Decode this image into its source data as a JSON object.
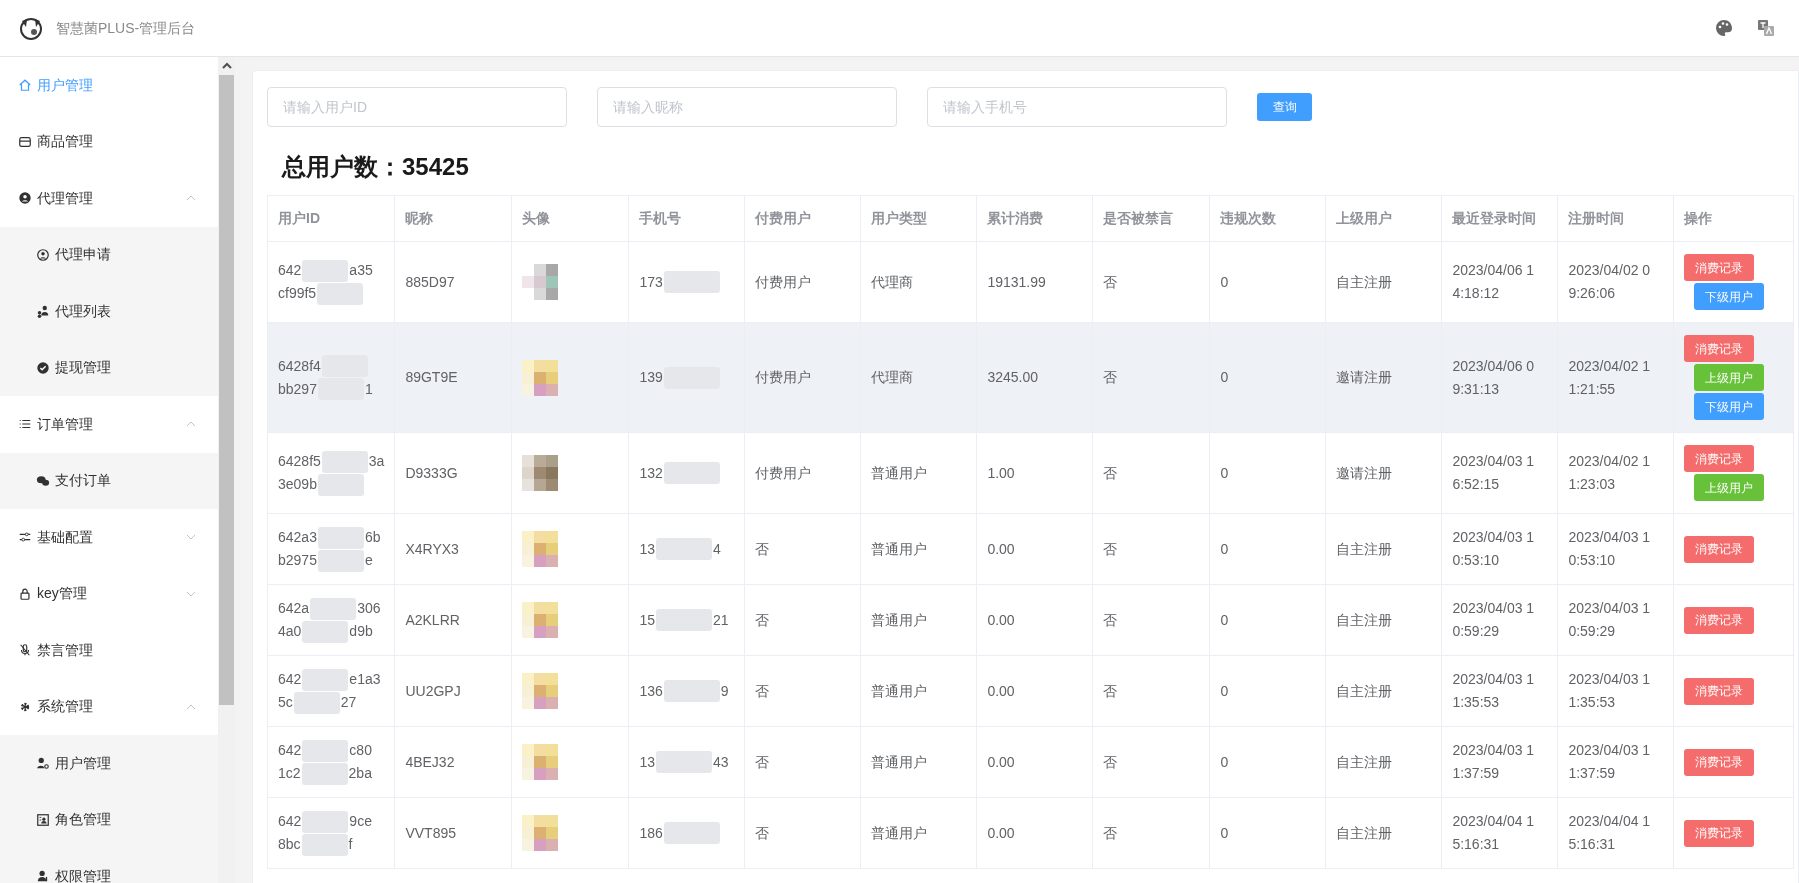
{
  "header": {
    "title": "智慧菌PLUS-管理后台"
  },
  "sidebar": {
    "items": [
      {
        "label": "用户管理",
        "selected": true
      },
      {
        "label": "商品管理",
        "selected": false
      },
      {
        "label": "代理管理",
        "selected": false,
        "expanded": true,
        "children": [
          {
            "label": "代理申请",
            "selected": false
          },
          {
            "label": "代理列表",
            "selected": false
          },
          {
            "label": "提现管理",
            "selected": false
          }
        ]
      },
      {
        "label": "订单管理",
        "selected": false,
        "expanded": true,
        "children": [
          {
            "label": "支付订单",
            "selected": false
          }
        ]
      },
      {
        "label": "基础配置",
        "selected": false,
        "expanded": false
      },
      {
        "label": "key管理",
        "selected": false,
        "expanded": false
      },
      {
        "label": "禁言管理",
        "selected": false
      },
      {
        "label": "系统管理",
        "selected": false,
        "expanded": true,
        "children": [
          {
            "label": "用户管理",
            "selected": false
          },
          {
            "label": "角色管理",
            "selected": false
          },
          {
            "label": "权限管理",
            "selected": false
          }
        ]
      }
    ]
  },
  "search": {
    "fields": [
      {
        "placeholder": "请输入用户ID"
      },
      {
        "placeholder": "请输入昵称"
      },
      {
        "placeholder": "请输入手机号"
      }
    ],
    "button": "查询"
  },
  "summary": "总用户数：35425",
  "table": {
    "columns": [
      "用户ID",
      "昵称",
      "头像",
      "手机号",
      "付费用户",
      "用户类型",
      "累计消费",
      "是否被禁言",
      "违规次数",
      "上级用户",
      "最近登录时间",
      "注册时间",
      "操作"
    ],
    "rows": [
      {
        "highlighted": false,
        "user_id": [
          {
            "head": "642",
            "tail": "a35"
          },
          {
            "head": "cf99f5"
          }
        ],
        "nickname": "885D97",
        "phone": {
          "head": "173"
        },
        "paid": "付费用户",
        "type": "代理商",
        "total": "19131.99",
        "muted": "否",
        "violations": "0",
        "parent": "自主注册",
        "last_login": "2023/04/06 14:18:12",
        "registered": "2023/04/02 09:26:06",
        "actions": [
          {
            "kind": "records",
            "label": "消费记录"
          },
          {
            "kind": "children",
            "label": "下级用户"
          }
        ]
      },
      {
        "highlighted": true,
        "user_id": [
          {
            "head": "6428f4"
          },
          {
            "head": "bb297",
            "tail": "1"
          }
        ],
        "nickname": "89GT9E",
        "phone": {
          "head": "139"
        },
        "paid": "付费用户",
        "type": "代理商",
        "total": "3245.00",
        "muted": "否",
        "violations": "0",
        "parent": "邀请注册",
        "last_login": "2023/04/06 09:31:13",
        "registered": "2023/04/02 11:21:55",
        "actions": [
          {
            "kind": "records",
            "label": "消费记录"
          },
          {
            "kind": "parent",
            "label": "上级用户"
          },
          {
            "kind": "children",
            "label": "下级用户"
          }
        ]
      },
      {
        "highlighted": false,
        "user_id": [
          {
            "head": "6428f5",
            "tail": "3a"
          },
          {
            "head": "3e09b"
          }
        ],
        "nickname": "D9333G",
        "phone": {
          "head": "132"
        },
        "paid": "付费用户",
        "type": "普通用户",
        "total": "1.00",
        "muted": "否",
        "violations": "0",
        "parent": "邀请注册",
        "last_login": "2023/04/03 16:52:15",
        "registered": "2023/04/02 11:23:03",
        "actions": [
          {
            "kind": "records",
            "label": "消费记录"
          },
          {
            "kind": "parent",
            "label": "上级用户"
          }
        ]
      },
      {
        "highlighted": false,
        "user_id": [
          {
            "head": "642a3",
            "tail": "6b"
          },
          {
            "head": "b2975",
            "tail": "e"
          }
        ],
        "nickname": "X4RYX3",
        "phone": {
          "head": "13",
          "tail": "4"
        },
        "paid": "否",
        "type": "普通用户",
        "total": "0.00",
        "muted": "否",
        "violations": "0",
        "parent": "自主注册",
        "last_login": "2023/04/03 10:53:10",
        "registered": "2023/04/03 10:53:10",
        "actions": [
          {
            "kind": "records",
            "label": "消费记录"
          }
        ]
      },
      {
        "highlighted": false,
        "user_id": [
          {
            "head": "642a",
            "tail": "306"
          },
          {
            "head": "4a0",
            "tail": "d9b"
          }
        ],
        "nickname": "A2KLRR",
        "phone": {
          "head": "15",
          "tail": "21"
        },
        "paid": "否",
        "type": "普通用户",
        "total": "0.00",
        "muted": "否",
        "violations": "0",
        "parent": "自主注册",
        "last_login": "2023/04/03 10:59:29",
        "registered": "2023/04/03 10:59:29",
        "actions": [
          {
            "kind": "records",
            "label": "消费记录"
          }
        ]
      },
      {
        "highlighted": false,
        "user_id": [
          {
            "head": "642",
            "tail": "e1a3"
          },
          {
            "head": "5c",
            "tail": "27"
          }
        ],
        "nickname": "UU2GPJ",
        "phone": {
          "head": "136",
          "tail": "9"
        },
        "paid": "否",
        "type": "普通用户",
        "total": "0.00",
        "muted": "否",
        "violations": "0",
        "parent": "自主注册",
        "last_login": "2023/04/03 11:35:53",
        "registered": "2023/04/03 11:35:53",
        "actions": [
          {
            "kind": "records",
            "label": "消费记录"
          }
        ]
      },
      {
        "highlighted": false,
        "user_id": [
          {
            "head": "642",
            "tail": "c80"
          },
          {
            "head": "1c2",
            "tail": "2ba"
          }
        ],
        "nickname": "4BEJ32",
        "phone": {
          "head": "13",
          "tail": "43"
        },
        "paid": "否",
        "type": "普通用户",
        "total": "0.00",
        "muted": "否",
        "violations": "0",
        "parent": "自主注册",
        "last_login": "2023/04/03 11:37:59",
        "registered": "2023/04/03 11:37:59",
        "actions": [
          {
            "kind": "records",
            "label": "消费记录"
          }
        ]
      },
      {
        "highlighted": false,
        "user_id": [
          {
            "head": "642",
            "tail": "9ce"
          },
          {
            "head": "8bc",
            "tail": "f"
          }
        ],
        "nickname": "VVT895",
        "phone": {
          "head": "186"
        },
        "paid": "否",
        "type": "普通用户",
        "total": "0.00",
        "muted": "否",
        "violations": "0",
        "parent": "自主注册",
        "last_login": "2023/04/04 15:16:31",
        "registered": "2023/04/04 15:16:31",
        "actions": [
          {
            "kind": "records",
            "label": "消费记录"
          }
        ]
      }
    ]
  }
}
